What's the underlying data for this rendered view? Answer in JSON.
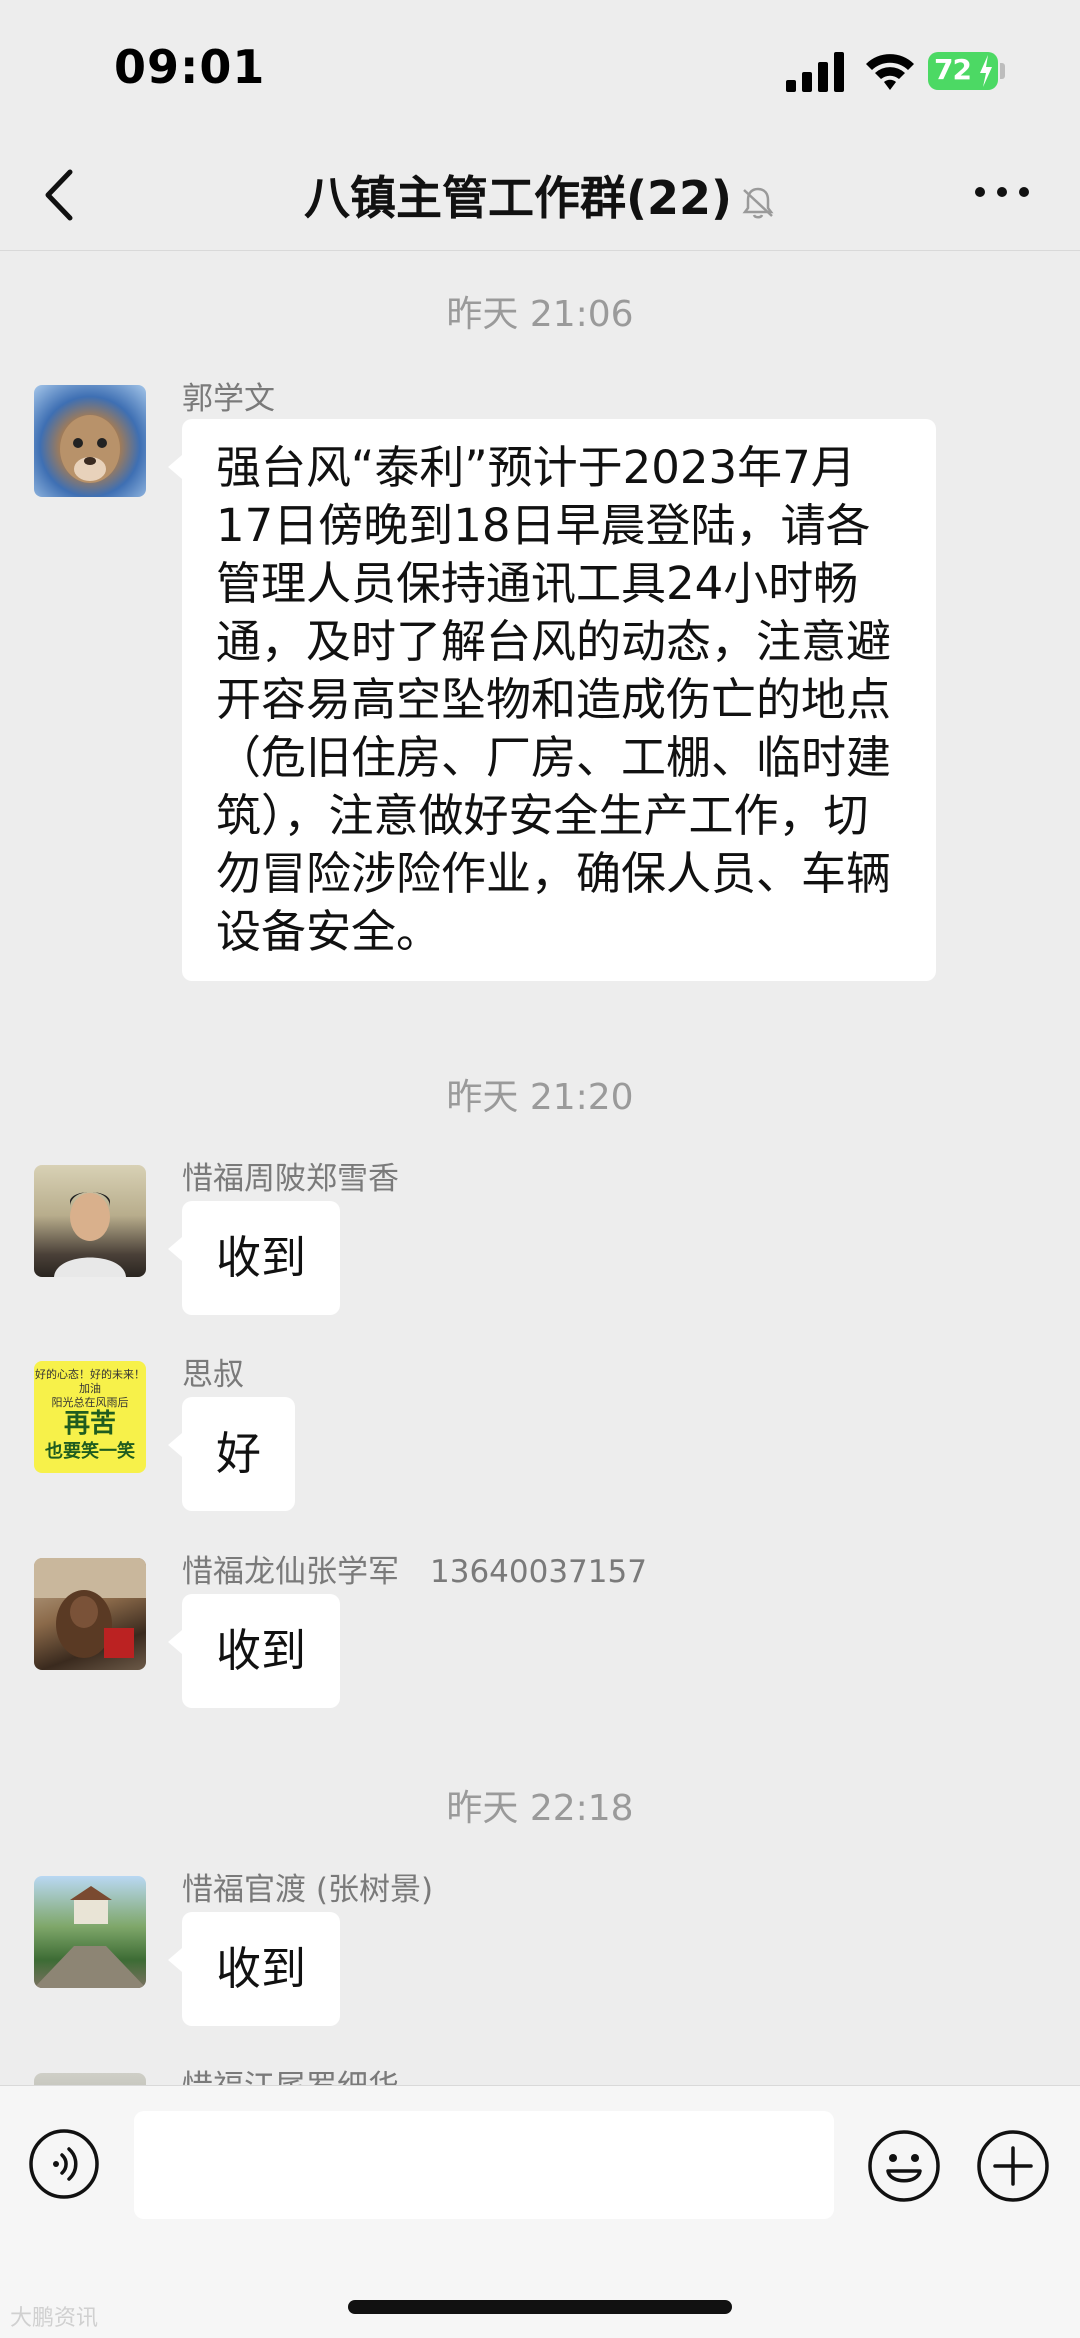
{
  "status_bar": {
    "time": "09:01",
    "battery": "72",
    "icons": [
      "signal-icon",
      "wifi-icon",
      "battery-icon",
      "charging-bolt-icon"
    ]
  },
  "nav": {
    "title": "八镇主管工作群(22)",
    "icons": [
      "back-icon",
      "mute-bell-icon",
      "more-icon"
    ]
  },
  "messages": [
    {
      "timestamp": "昨天 21:06",
      "sender": "郭学文",
      "text": "强台风“泰利”预计于2023年7月17日傍晚到18日早晨登陆，请各管理人员保持通讯工具24小时畅通，及时了解台风的动态，注意避开容易高空坠物和造成伤亡的地点（危旧住房、厂房、工棚、临时建筑），注意做好安全生产工作，切勿冒险涉险作业，确保人员、车辆设备安全。"
    },
    {
      "timestamp": "昨天 21:20",
      "sender": "惜福周陂郑雪香",
      "text": "收到"
    },
    {
      "sender": "思叔",
      "text": "好",
      "avatar_text": [
        "好的心态！好的未来！加油",
        "阳光总在风雨后",
        "再苦",
        "也要笑一笑"
      ]
    },
    {
      "sender": "惜福龙仙张学军　13640037157",
      "text": "收到"
    },
    {
      "timestamp": "昨天 22:18",
      "sender": "惜福官渡 (张树景)",
      "text": "收到"
    },
    {
      "sender": "惜福江尾罗细华"
    }
  ],
  "input_bar": {
    "placeholder": "",
    "icons": [
      "voice-icon",
      "emoji-icon",
      "plus-icon"
    ]
  },
  "watermark": "大鹏资讯"
}
